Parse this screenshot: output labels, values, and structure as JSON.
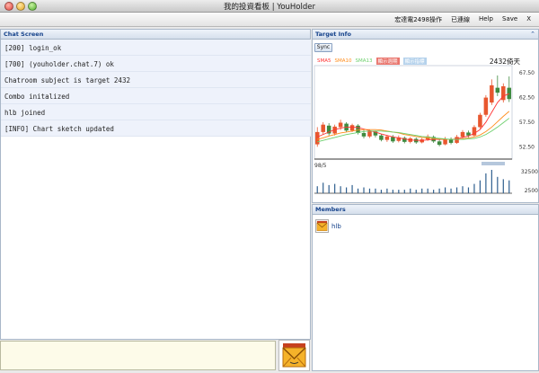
{
  "window": {
    "title": "我的投資看板 | YouHolder"
  },
  "menubar": {
    "items": [
      "宏達電2498操作",
      "已連線",
      "Help",
      "Save",
      "X"
    ]
  },
  "chat": {
    "title": "Chat Screen",
    "lines": [
      "[200] login_ok",
      "[700] (youholder.chat.7) ok",
      "Chatroom subject is target 2432",
      "Combo initalized",
      "hlb joined",
      "[INFO] Chart sketch updated"
    ],
    "input_value": ""
  },
  "target": {
    "title": "Target Info",
    "sync_label": "Sync",
    "legend": [
      "SMA5",
      "SMA10",
      "SMA13",
      "顯示週期",
      "顯示指標"
    ],
    "stock_label": "2432倚天",
    "colors": {
      "sma5": "#ff3333",
      "sma10": "#ff8c1a",
      "sma13": "#6ccf6c",
      "up": "#e8572f",
      "down": "#3f8a3f"
    }
  },
  "chart_data": {
    "type": "candlestick",
    "x_start_label": "98/5",
    "price_ticks": [
      67.5,
      62.5,
      57.5,
      52.5
    ],
    "volume_ticks": [
      32500,
      2500
    ],
    "ylim": [
      50,
      69
    ],
    "candles": [
      {
        "o": 53.0,
        "c": 55.5,
        "h": 56.5,
        "l": 52.5,
        "v": 0.3
      },
      {
        "o": 55.5,
        "c": 57.0,
        "h": 57.5,
        "l": 55.0,
        "v": 0.45
      },
      {
        "o": 56.8,
        "c": 55.2,
        "h": 57.3,
        "l": 54.8,
        "v": 0.35
      },
      {
        "o": 55.2,
        "c": 56.6,
        "h": 57.0,
        "l": 54.8,
        "v": 0.4
      },
      {
        "o": 56.5,
        "c": 57.4,
        "h": 58.0,
        "l": 55.9,
        "v": 0.3
      },
      {
        "o": 57.2,
        "c": 55.8,
        "h": 57.5,
        "l": 55.5,
        "v": 0.25
      },
      {
        "o": 55.8,
        "c": 56.9,
        "h": 57.2,
        "l": 55.5,
        "v": 0.35
      },
      {
        "o": 56.8,
        "c": 55.3,
        "h": 57.1,
        "l": 55.0,
        "v": 0.2
      },
      {
        "o": 55.3,
        "c": 54.6,
        "h": 55.9,
        "l": 54.2,
        "v": 0.25
      },
      {
        "o": 54.6,
        "c": 55.7,
        "h": 56.0,
        "l": 54.3,
        "v": 0.2
      },
      {
        "o": 55.6,
        "c": 54.8,
        "h": 55.8,
        "l": 54.4,
        "v": 0.2
      },
      {
        "o": 54.8,
        "c": 53.9,
        "h": 55.1,
        "l": 53.6,
        "v": 0.15
      },
      {
        "o": 53.9,
        "c": 54.6,
        "h": 54.9,
        "l": 53.5,
        "v": 0.2
      },
      {
        "o": 54.5,
        "c": 53.6,
        "h": 54.9,
        "l": 53.3,
        "v": 0.15
      },
      {
        "o": 53.7,
        "c": 54.4,
        "h": 54.8,
        "l": 53.4,
        "v": 0.15
      },
      {
        "o": 54.3,
        "c": 53.5,
        "h": 54.6,
        "l": 53.2,
        "v": 0.15
      },
      {
        "o": 53.5,
        "c": 54.2,
        "h": 54.5,
        "l": 53.2,
        "v": 0.2
      },
      {
        "o": 54.1,
        "c": 53.4,
        "h": 54.4,
        "l": 53.1,
        "v": 0.15
      },
      {
        "o": 53.4,
        "c": 54.0,
        "h": 54.3,
        "l": 53.2,
        "v": 0.2
      },
      {
        "o": 54.0,
        "c": 54.6,
        "h": 55.0,
        "l": 53.7,
        "v": 0.2
      },
      {
        "o": 54.5,
        "c": 53.6,
        "h": 54.8,
        "l": 53.3,
        "v": 0.15
      },
      {
        "o": 53.6,
        "c": 52.9,
        "h": 54.0,
        "l": 52.6,
        "v": 0.2
      },
      {
        "o": 53.0,
        "c": 54.1,
        "h": 54.5,
        "l": 52.8,
        "v": 0.25
      },
      {
        "o": 54.1,
        "c": 53.3,
        "h": 54.4,
        "l": 53.0,
        "v": 0.2
      },
      {
        "o": 53.3,
        "c": 54.5,
        "h": 54.9,
        "l": 53.1,
        "v": 0.25
      },
      {
        "o": 54.5,
        "c": 55.5,
        "h": 55.9,
        "l": 54.2,
        "v": 0.3
      },
      {
        "o": 55.4,
        "c": 54.8,
        "h": 55.8,
        "l": 54.4,
        "v": 0.25
      },
      {
        "o": 54.8,
        "c": 56.5,
        "h": 56.9,
        "l": 54.5,
        "v": 0.4
      },
      {
        "o": 56.5,
        "c": 59.0,
        "h": 59.4,
        "l": 56.2,
        "v": 0.55
      },
      {
        "o": 59.0,
        "c": 62.5,
        "h": 63.0,
        "l": 58.6,
        "v": 0.85
      },
      {
        "o": 61.5,
        "c": 65.0,
        "h": 66.2,
        "l": 61.0,
        "v": 1.0
      },
      {
        "o": 64.5,
        "c": 63.5,
        "h": 67.0,
        "l": 62.8,
        "v": 0.7
      },
      {
        "o": 62.0,
        "c": 64.8,
        "h": 65.4,
        "l": 61.5,
        "v": 0.6
      },
      {
        "o": 64.5,
        "c": 62.2,
        "h": 66.8,
        "l": 61.6,
        "v": 0.55
      }
    ],
    "sma5": [
      54.5,
      55.0,
      55.5,
      56.0,
      56.3,
      56.5,
      56.5,
      56.4,
      56.1,
      55.8,
      55.5,
      55.1,
      54.8,
      54.5,
      54.3,
      54.1,
      53.9,
      53.8,
      53.8,
      53.9,
      54.0,
      54.0,
      54.0,
      54.0,
      54.1,
      54.4,
      54.7,
      55.2,
      56.0,
      57.5,
      59.5,
      61.5,
      62.8,
      63.3
    ],
    "sma10": [
      54.0,
      54.3,
      54.7,
      55.0,
      55.3,
      55.5,
      55.7,
      55.9,
      56.0,
      56.0,
      56.0,
      55.9,
      55.7,
      55.5,
      55.3,
      55.0,
      54.8,
      54.6,
      54.4,
      54.3,
      54.2,
      54.1,
      54.0,
      54.0,
      54.0,
      54.1,
      54.3,
      54.5,
      54.9,
      55.6,
      56.5,
      57.6,
      58.7,
      59.7
    ],
    "sma13": [
      53.5,
      53.8,
      54.1,
      54.4,
      54.7,
      55.0,
      55.2,
      55.4,
      55.6,
      55.7,
      55.7,
      55.7,
      55.6,
      55.5,
      55.4,
      55.2,
      55.0,
      54.8,
      54.6,
      54.5,
      54.3,
      54.2,
      54.1,
      54.0,
      54.0,
      54.0,
      54.1,
      54.2,
      54.5,
      55.0,
      55.7,
      56.5,
      57.4,
      58.3
    ]
  },
  "members": {
    "title": "Members",
    "list": [
      {
        "name": "hlb"
      }
    ]
  }
}
